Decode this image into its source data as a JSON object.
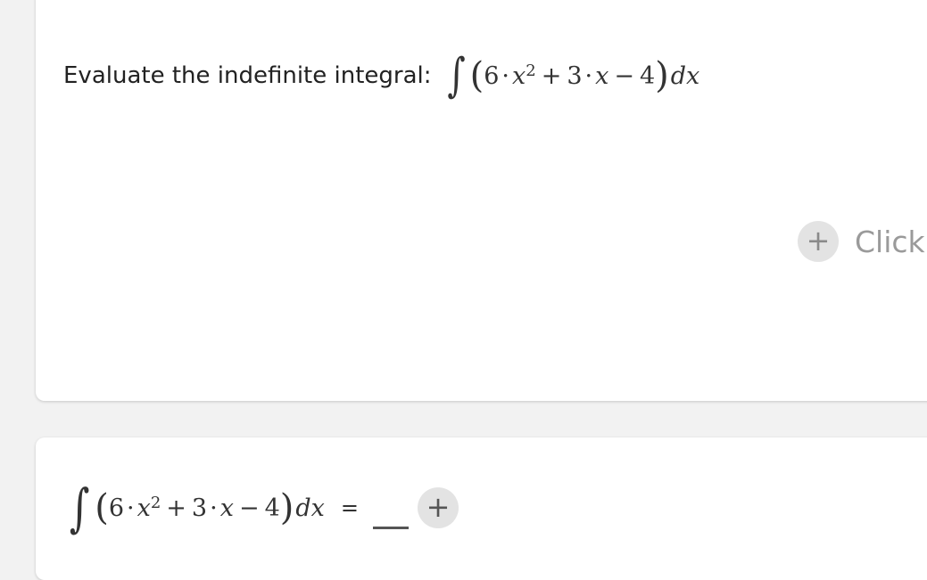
{
  "question": {
    "prompt": "Evaluate the indefinite integral:",
    "integral_sign": "∫",
    "open_paren": "(",
    "close_paren": ")",
    "coef1": "6",
    "dot": "·",
    "var": "x",
    "exp": "2",
    "plus": "+",
    "coef2": "3",
    "minus": "−",
    "const": "4",
    "dx": "dx"
  },
  "add_block": {
    "icon": "+",
    "label": "Click"
  },
  "answer": {
    "equals": "=",
    "add_icon": "+"
  }
}
